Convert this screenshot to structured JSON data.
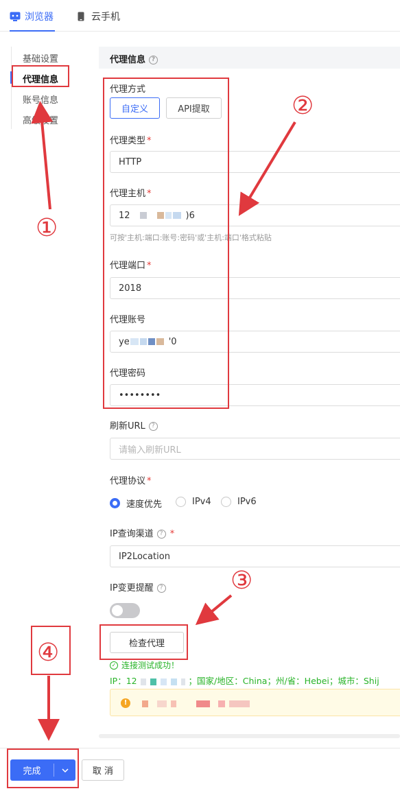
{
  "tabs": [
    {
      "label": "浏览器",
      "icon": "browser-icon",
      "active": true
    },
    {
      "label": "云手机",
      "icon": "phone-icon",
      "active": false
    }
  ],
  "sidebar": {
    "items": [
      {
        "label": "基础设置"
      },
      {
        "label": "代理信息",
        "active": true
      },
      {
        "label": "账号信息"
      },
      {
        "label": "高级设置"
      }
    ]
  },
  "section": {
    "title": "代理信息"
  },
  "form": {
    "proxy_method": {
      "label": "代理方式",
      "options": [
        "自定义",
        "API提取"
      ],
      "selected": "自定义"
    },
    "proxy_type": {
      "label": "代理类型",
      "value": "HTTP"
    },
    "proxy_host": {
      "label": "代理主机",
      "value_start": "12",
      "value_end": ")6",
      "hint": "可按'主机:端口:账号:密码'或'主机:端口'格式粘贴"
    },
    "proxy_port": {
      "label": "代理端口",
      "value": "2018"
    },
    "proxy_account": {
      "label": "代理账号",
      "value_start": "ye",
      "value_end": "'0"
    },
    "proxy_password": {
      "label": "代理密码",
      "value": "••••••••"
    },
    "refresh_url": {
      "label": "刷新URL",
      "placeholder": "请输入刷新URL"
    },
    "protocol": {
      "label": "代理协议",
      "options": [
        "速度优先",
        "IPv4",
        "IPv6"
      ],
      "selected": "速度优先"
    },
    "ip_channel": {
      "label": "IP查询渠道",
      "value": "IP2Location"
    },
    "ip_change": {
      "label": "IP变更提醒",
      "enabled": false
    },
    "check_button": "检查代理",
    "result": {
      "success": "连接测试成功！",
      "ip_prefix": "IP：12",
      "ip_suffix": "；国家/地区：China；州/省：Hebei；城市：Shij"
    }
  },
  "footer": {
    "done_label": "完成",
    "cancel_label": "取 消"
  },
  "annotations": [
    "①",
    "②",
    "③",
    "④"
  ],
  "colors": {
    "accent": "#3b6cf6",
    "annotation": "#e0393e",
    "success": "#27b327",
    "required": "#e53935"
  }
}
